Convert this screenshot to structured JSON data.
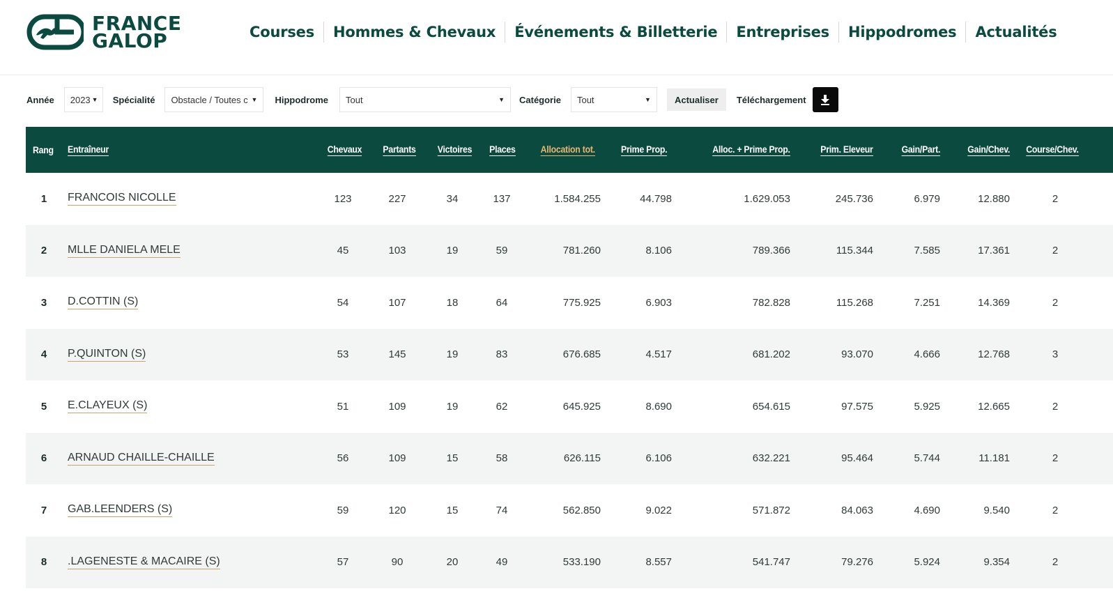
{
  "brand": {
    "line1": "FRANCE",
    "line2": "GALOP",
    "primary_color": "#0b4a3f",
    "accent_color": "#e8b570"
  },
  "nav": [
    "Courses",
    "Hommes & Chevaux",
    "Événements & Billetterie",
    "Entreprises",
    "Hippodromes",
    "Actualités"
  ],
  "filters": {
    "annee_label": "Année",
    "annee_value": "2023",
    "specialite_label": "Spécialité",
    "specialite_value": "Obstacle / Toutes c",
    "hippodrome_label": "Hippodrome",
    "hippodrome_value": "Tout",
    "categorie_label": "Catégorie",
    "categorie_value": "Tout",
    "actualiser_label": "Actualiser",
    "telechargement_label": "Téléchargement",
    "download_icon": "download-icon"
  },
  "table": {
    "headers": [
      "Rang",
      "Entraîneur",
      "Chevaux",
      "Partants",
      "Victoires",
      "Places",
      "Allocation tot.",
      "Prime Prop.",
      "Alloc. + Prime Prop.",
      "Prim. Eleveur",
      "Gain/Part.",
      "Gain/Chev.",
      "Course/Chev."
    ],
    "sorted_column": "Allocation tot.",
    "rows": [
      [
        "1",
        "FRANCOIS NICOLLE",
        "123",
        "227",
        "34",
        "137",
        "1.584.255",
        "44.798",
        "1.629.053",
        "245.736",
        "6.979",
        "12.880",
        "2"
      ],
      [
        "2",
        "MLLE DANIELA MELE",
        "45",
        "103",
        "19",
        "59",
        "781.260",
        "8.106",
        "789.366",
        "115.344",
        "7.585",
        "17.361",
        "2"
      ],
      [
        "3",
        "D.COTTIN (S)",
        "54",
        "107",
        "18",
        "64",
        "775.925",
        "6.903",
        "782.828",
        "115.268",
        "7.251",
        "14.369",
        "2"
      ],
      [
        "4",
        "P.QUINTON (S)",
        "53",
        "145",
        "19",
        "83",
        "676.685",
        "4.517",
        "681.202",
        "93.070",
        "4.666",
        "12.768",
        "3"
      ],
      [
        "5",
        "E.CLAYEUX (S)",
        "51",
        "109",
        "19",
        "62",
        "645.925",
        "8.690",
        "654.615",
        "97.575",
        "5.925",
        "12.665",
        "2"
      ],
      [
        "6",
        "ARNAUD CHAILLE-CHAILLE",
        "56",
        "109",
        "15",
        "58",
        "626.115",
        "6.106",
        "632.221",
        "95.464",
        "5.744",
        "11.181",
        "2"
      ],
      [
        "7",
        "GAB.LEENDERS (S)",
        "59",
        "120",
        "15",
        "74",
        "562.850",
        "9.022",
        "571.872",
        "84.063",
        "4.690",
        "9.540",
        "2"
      ],
      [
        "8",
        ".LAGENESTE & MACAIRE (S)",
        "57",
        "90",
        "20",
        "49",
        "533.190",
        "8.557",
        "541.747",
        "79.276",
        "5.924",
        "9.354",
        "2"
      ]
    ]
  }
}
